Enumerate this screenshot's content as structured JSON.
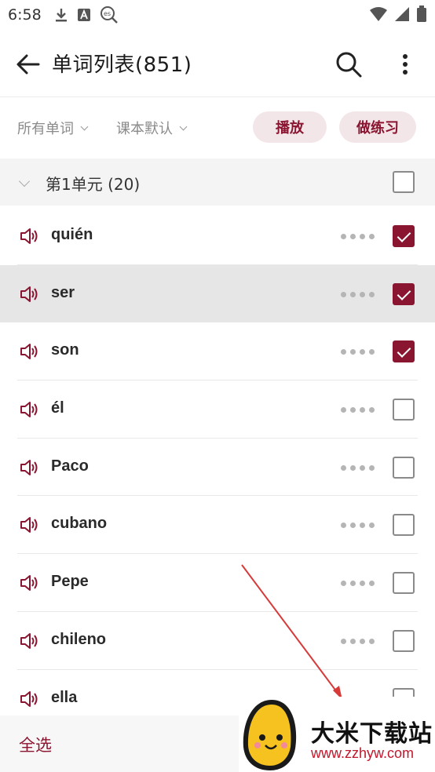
{
  "status_bar": {
    "time": "6:58",
    "icons": [
      "download-icon",
      "a-badge-icon",
      "es-search-icon"
    ],
    "right_icons": [
      "wifi-icon",
      "signal-icon",
      "battery-icon"
    ]
  },
  "app_bar": {
    "title": "单词列表(851)",
    "back_icon": "arrow-left-icon",
    "search_icon": "search-icon",
    "menu_icon": "more-vertical-icon"
  },
  "filters": {
    "scope_label": "所有单词",
    "order_label": "课本默认",
    "play_button": "播放",
    "practice_button": "做练习"
  },
  "unit": {
    "title": "第1单元 (20)",
    "checked": false
  },
  "words": [
    {
      "word": "quién",
      "checked": true,
      "highlight": false
    },
    {
      "word": "ser",
      "checked": true,
      "highlight": true
    },
    {
      "word": "son",
      "checked": true,
      "highlight": false
    },
    {
      "word": "él",
      "checked": false,
      "highlight": false
    },
    {
      "word": "Paco",
      "checked": false,
      "highlight": false
    },
    {
      "word": "cubano",
      "checked": false,
      "highlight": false
    },
    {
      "word": "Pepe",
      "checked": false,
      "highlight": false
    },
    {
      "word": "chileno",
      "checked": false,
      "highlight": false
    },
    {
      "word": "ella",
      "checked": false,
      "highlight": false
    }
  ],
  "bottom_bar": {
    "select_all": "全选"
  },
  "watermark": {
    "title": "大米下载站",
    "url": "www.zzhyw.com"
  },
  "colors": {
    "accent": "#8a1530",
    "pill_bg": "#f3e6e8",
    "highlight_row": "#e6e6e6",
    "watermark_url": "#c0182c"
  }
}
